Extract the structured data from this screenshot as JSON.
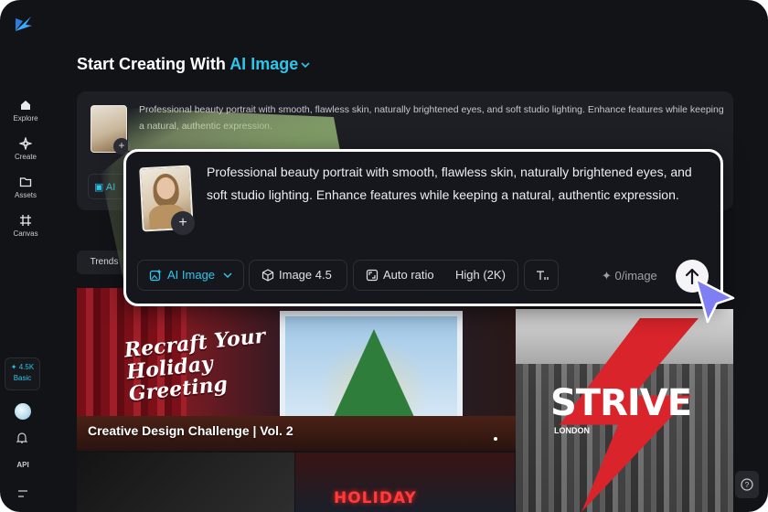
{
  "sidebar": {
    "items": [
      {
        "label": "Explore",
        "icon": "home-icon"
      },
      {
        "label": "Create",
        "icon": "sparkle-icon"
      },
      {
        "label": "Assets",
        "icon": "folder-icon"
      },
      {
        "label": "Canvas",
        "icon": "canvas-grid-icon"
      }
    ],
    "credits_amount": "4.5K",
    "plan_label": "Basic",
    "api_label": "API"
  },
  "heading": {
    "prefix": "Start Creating With",
    "accent": "AI Image",
    "accent_color": "#2ec5ea"
  },
  "bg_prompt": {
    "text": "Professional beauty portrait with smooth, flawless skin, naturally brightened eyes, and soft studio lighting. Enhance features while keeping a natural, authentic expression.",
    "chip_label": "AI"
  },
  "tabs": {
    "trends_label": "Trends"
  },
  "gallery": {
    "main_title": "Recraft Your Holiday Greeting",
    "main_caption": "Creative Design Challenge | Vol. 2",
    "right_title": "STRIVE",
    "right_subtitle": "LONDON",
    "bottom_sign": "HOLIDAY"
  },
  "prompt": {
    "text": "Professional beauty portrait with smooth, flawless skin, naturally brightened eyes, and soft studio lighting. Enhance features while keeping a natural, authentic expression.",
    "mode_label": "AI Image",
    "model_label": "Image 4.5",
    "ratio_label": "Auto ratio",
    "quality_label": "High (2K)",
    "cost_label": "0/image"
  },
  "colors": {
    "background": "#121317",
    "accent": "#2ec5ea",
    "card": "#1d1f25"
  }
}
